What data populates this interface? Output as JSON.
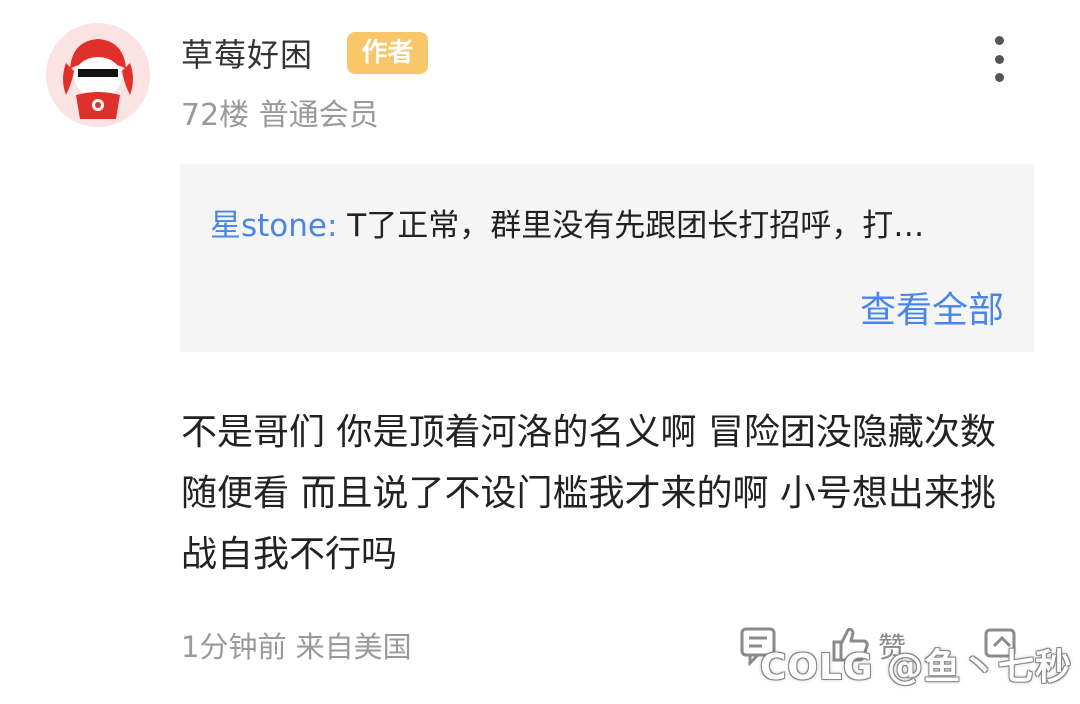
{
  "post": {
    "username": "草莓好困",
    "author_badge": "作者",
    "floor_and_role": "72楼 普通会员",
    "quote": {
      "name": "星stone:",
      "text": "T了正常，群里没有先跟团长打招呼，打…",
      "view_all": "查看全部"
    },
    "content": "不是哥们 你是顶着河洛的名义啊 冒险团没隐藏次数随便看 而且说了不设门槛我才来的啊 小号想出来挑战自我不行吗",
    "time_location": "1分钟前 来自美国",
    "actions": {
      "like_label": "赞",
      "icons": [
        "comment-icon",
        "like-icon",
        "share-icon"
      ]
    }
  },
  "watermark": "COLG @鱼丶七秒",
  "colors": {
    "link_blue": "#4a86e8",
    "badge_orange": "#f7c76a",
    "quote_bg": "#f5f5f5",
    "meta_gray": "#9a9a9a"
  }
}
